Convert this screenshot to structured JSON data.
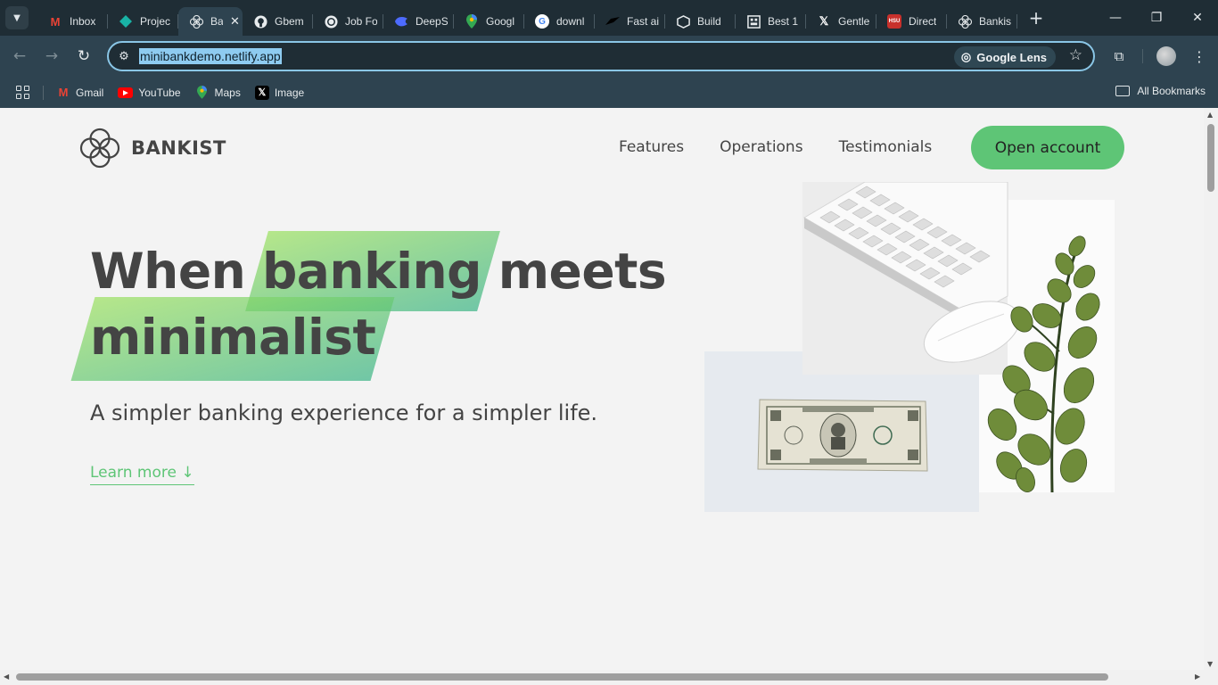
{
  "browser": {
    "tabs": [
      {
        "title": "Inbox",
        "icon": "gmail-icon",
        "active": false
      },
      {
        "title": "Projec",
        "icon": "diamond-icon",
        "active": false
      },
      {
        "title": "Ba",
        "icon": "bankist-icon",
        "active": true
      },
      {
        "title": "Gbem",
        "icon": "github-icon",
        "active": false
      },
      {
        "title": "Job Fo",
        "icon": "chatgpt-icon",
        "active": false
      },
      {
        "title": "DeepS",
        "icon": "deepseek-icon",
        "active": false
      },
      {
        "title": "Googl",
        "icon": "maps-icon",
        "active": false
      },
      {
        "title": "downl",
        "icon": "google-icon",
        "active": false
      },
      {
        "title": "Fast ai",
        "icon": "fast-icon",
        "active": false
      },
      {
        "title": "Build",
        "icon": "box-icon",
        "active": false
      },
      {
        "title": "Best 1",
        "icon": "grid-icon",
        "active": false
      },
      {
        "title": "Gentle",
        "icon": "x-icon",
        "active": false
      },
      {
        "title": "Direct",
        "icon": "hsu-icon",
        "active": false
      },
      {
        "title": "Bankis",
        "icon": "bankist-icon",
        "active": false
      }
    ],
    "url": "minibankdemo.netlify.app",
    "lens_label": "Google Lens",
    "bookmarks": [
      {
        "label": "Gmail",
        "icon": "gmail-icon"
      },
      {
        "label": "YouTube",
        "icon": "youtube-icon"
      },
      {
        "label": "Maps",
        "icon": "maps-icon"
      },
      {
        "label": "Image",
        "icon": "x-icon"
      }
    ],
    "all_bookmarks_label": "All Bookmarks",
    "colors": {
      "chrome_dark": "#1f2d35",
      "chrome_mid": "#2e4350",
      "omnibox_border": "#8ac6e6"
    }
  },
  "page": {
    "logo_text": "BANKIST",
    "nav": {
      "features": "Features",
      "operations": "Operations",
      "testimonials": "Testimonials",
      "open_account": "Open account"
    },
    "headline": {
      "word1": "When",
      "highlight1": "banking",
      "word2": "meets",
      "highlight2": "minimalist"
    },
    "subheading": "A simpler banking experience for a simpler life.",
    "learn_more": "Learn more ↓",
    "colors": {
      "primary": "#5ec576",
      "text": "#444444",
      "background": "#f3f3f3"
    }
  }
}
